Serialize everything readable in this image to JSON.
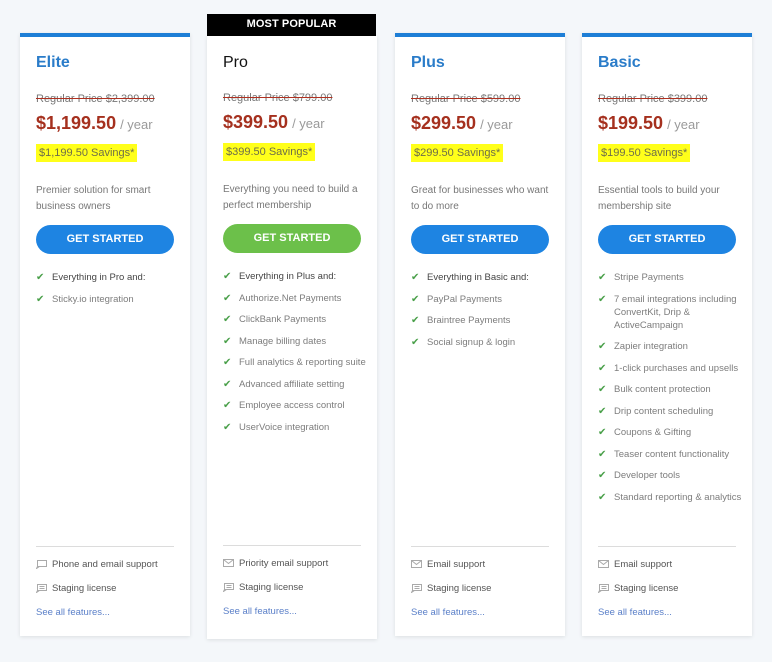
{
  "badge": "MOST POPULAR",
  "plans": [
    {
      "name": "Elite",
      "regular_price": "Regular Price $2,399.00",
      "price": "$1,199.50",
      "period": "/ year",
      "savings": "$1,199.50 Savings*",
      "description": "Premier solution for smart business owners",
      "cta": "GET STARTED",
      "features": [
        "Everything in Pro and:",
        "Sticky.io integration"
      ],
      "support": "Phone and email support",
      "support_icon": "phone-chat-icon",
      "staging": "Staging license",
      "see_all": "See all features..."
    },
    {
      "name": "Pro",
      "regular_price": "Regular Price $799.00",
      "price": "$399.50",
      "period": "/ year",
      "savings": "$399.50 Savings*",
      "description": "Everything you need to build a perfect membership",
      "cta": "GET STARTED",
      "features": [
        "Everything in Plus and:",
        "Authorize.Net Payments",
        "ClickBank Payments",
        "Manage billing dates",
        "Full analytics & reporting suite",
        "Advanced affiliate setting",
        "Employee access control",
        "UserVoice integration"
      ],
      "support": "Priority email support",
      "support_icon": "email-icon",
      "staging": "Staging license",
      "see_all": "See all features..."
    },
    {
      "name": "Plus",
      "regular_price": "Regular Price $599.00",
      "price": "$299.50",
      "period": "/ year",
      "savings": "$299.50 Savings*",
      "description": "Great for businesses who want to do more",
      "cta": "GET STARTED",
      "features": [
        "Everything in Basic and:",
        "PayPal Payments",
        "Braintree Payments",
        "Social signup & login"
      ],
      "support": "Email support",
      "support_icon": "email-icon",
      "staging": "Staging license",
      "see_all": "See all features..."
    },
    {
      "name": "Basic",
      "regular_price": "Regular Price $399.00",
      "price": "$199.50",
      "period": "/ year",
      "savings": "$199.50 Savings*",
      "description": "Essential tools to build your membership site",
      "cta": "GET STARTED",
      "features": [
        "Stripe Payments",
        "7 email integrations including ConvertKit, Drip & ActiveCampaign",
        "Zapier integration",
        "1-click purchases and upsells",
        "Bulk content protection",
        "Drip content scheduling",
        "Coupons & Gifting",
        "Teaser content functionality",
        "Developer tools",
        "Standard reporting & analytics"
      ],
      "support": "Email support",
      "support_icon": "email-icon",
      "staging": "Staging license",
      "see_all": "See all features..."
    }
  ],
  "colors": {
    "accent_blue": "#1e84e2",
    "popular_green": "#6cc04a",
    "price_red": "#a5301e",
    "savings_highlight": "#ffff1a"
  }
}
